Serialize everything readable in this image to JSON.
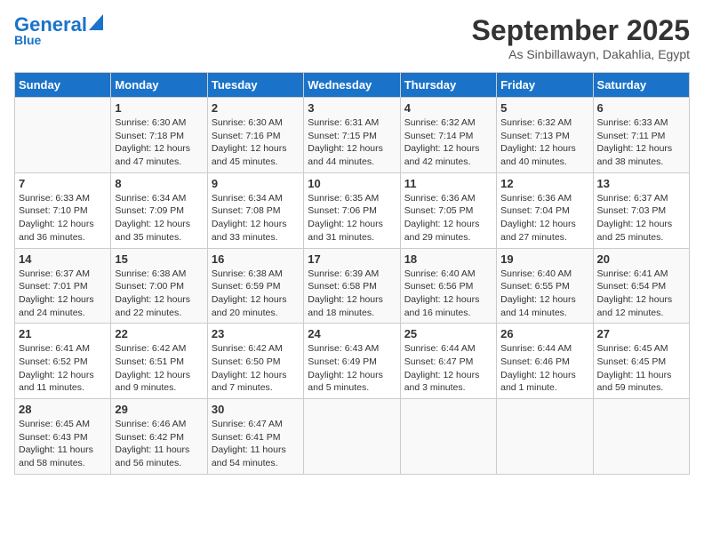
{
  "header": {
    "logo_general": "General",
    "logo_blue": "Blue",
    "month_title": "September 2025",
    "location": "As Sinbillawayn, Dakahlia, Egypt"
  },
  "weekdays": [
    "Sunday",
    "Monday",
    "Tuesday",
    "Wednesday",
    "Thursday",
    "Friday",
    "Saturday"
  ],
  "weeks": [
    [
      {
        "day": "",
        "info": ""
      },
      {
        "day": "1",
        "info": "Sunrise: 6:30 AM\nSunset: 7:18 PM\nDaylight: 12 hours\nand 47 minutes."
      },
      {
        "day": "2",
        "info": "Sunrise: 6:30 AM\nSunset: 7:16 PM\nDaylight: 12 hours\nand 45 minutes."
      },
      {
        "day": "3",
        "info": "Sunrise: 6:31 AM\nSunset: 7:15 PM\nDaylight: 12 hours\nand 44 minutes."
      },
      {
        "day": "4",
        "info": "Sunrise: 6:32 AM\nSunset: 7:14 PM\nDaylight: 12 hours\nand 42 minutes."
      },
      {
        "day": "5",
        "info": "Sunrise: 6:32 AM\nSunset: 7:13 PM\nDaylight: 12 hours\nand 40 minutes."
      },
      {
        "day": "6",
        "info": "Sunrise: 6:33 AM\nSunset: 7:11 PM\nDaylight: 12 hours\nand 38 minutes."
      }
    ],
    [
      {
        "day": "7",
        "info": "Sunrise: 6:33 AM\nSunset: 7:10 PM\nDaylight: 12 hours\nand 36 minutes."
      },
      {
        "day": "8",
        "info": "Sunrise: 6:34 AM\nSunset: 7:09 PM\nDaylight: 12 hours\nand 35 minutes."
      },
      {
        "day": "9",
        "info": "Sunrise: 6:34 AM\nSunset: 7:08 PM\nDaylight: 12 hours\nand 33 minutes."
      },
      {
        "day": "10",
        "info": "Sunrise: 6:35 AM\nSunset: 7:06 PM\nDaylight: 12 hours\nand 31 minutes."
      },
      {
        "day": "11",
        "info": "Sunrise: 6:36 AM\nSunset: 7:05 PM\nDaylight: 12 hours\nand 29 minutes."
      },
      {
        "day": "12",
        "info": "Sunrise: 6:36 AM\nSunset: 7:04 PM\nDaylight: 12 hours\nand 27 minutes."
      },
      {
        "day": "13",
        "info": "Sunrise: 6:37 AM\nSunset: 7:03 PM\nDaylight: 12 hours\nand 25 minutes."
      }
    ],
    [
      {
        "day": "14",
        "info": "Sunrise: 6:37 AM\nSunset: 7:01 PM\nDaylight: 12 hours\nand 24 minutes."
      },
      {
        "day": "15",
        "info": "Sunrise: 6:38 AM\nSunset: 7:00 PM\nDaylight: 12 hours\nand 22 minutes."
      },
      {
        "day": "16",
        "info": "Sunrise: 6:38 AM\nSunset: 6:59 PM\nDaylight: 12 hours\nand 20 minutes."
      },
      {
        "day": "17",
        "info": "Sunrise: 6:39 AM\nSunset: 6:58 PM\nDaylight: 12 hours\nand 18 minutes."
      },
      {
        "day": "18",
        "info": "Sunrise: 6:40 AM\nSunset: 6:56 PM\nDaylight: 12 hours\nand 16 minutes."
      },
      {
        "day": "19",
        "info": "Sunrise: 6:40 AM\nSunset: 6:55 PM\nDaylight: 12 hours\nand 14 minutes."
      },
      {
        "day": "20",
        "info": "Sunrise: 6:41 AM\nSunset: 6:54 PM\nDaylight: 12 hours\nand 12 minutes."
      }
    ],
    [
      {
        "day": "21",
        "info": "Sunrise: 6:41 AM\nSunset: 6:52 PM\nDaylight: 12 hours\nand 11 minutes."
      },
      {
        "day": "22",
        "info": "Sunrise: 6:42 AM\nSunset: 6:51 PM\nDaylight: 12 hours\nand 9 minutes."
      },
      {
        "day": "23",
        "info": "Sunrise: 6:42 AM\nSunset: 6:50 PM\nDaylight: 12 hours\nand 7 minutes."
      },
      {
        "day": "24",
        "info": "Sunrise: 6:43 AM\nSunset: 6:49 PM\nDaylight: 12 hours\nand 5 minutes."
      },
      {
        "day": "25",
        "info": "Sunrise: 6:44 AM\nSunset: 6:47 PM\nDaylight: 12 hours\nand 3 minutes."
      },
      {
        "day": "26",
        "info": "Sunrise: 6:44 AM\nSunset: 6:46 PM\nDaylight: 12 hours\nand 1 minute."
      },
      {
        "day": "27",
        "info": "Sunrise: 6:45 AM\nSunset: 6:45 PM\nDaylight: 11 hours\nand 59 minutes."
      }
    ],
    [
      {
        "day": "28",
        "info": "Sunrise: 6:45 AM\nSunset: 6:43 PM\nDaylight: 11 hours\nand 58 minutes."
      },
      {
        "day": "29",
        "info": "Sunrise: 6:46 AM\nSunset: 6:42 PM\nDaylight: 11 hours\nand 56 minutes."
      },
      {
        "day": "30",
        "info": "Sunrise: 6:47 AM\nSunset: 6:41 PM\nDaylight: 11 hours\nand 54 minutes."
      },
      {
        "day": "",
        "info": ""
      },
      {
        "day": "",
        "info": ""
      },
      {
        "day": "",
        "info": ""
      },
      {
        "day": "",
        "info": ""
      }
    ]
  ]
}
